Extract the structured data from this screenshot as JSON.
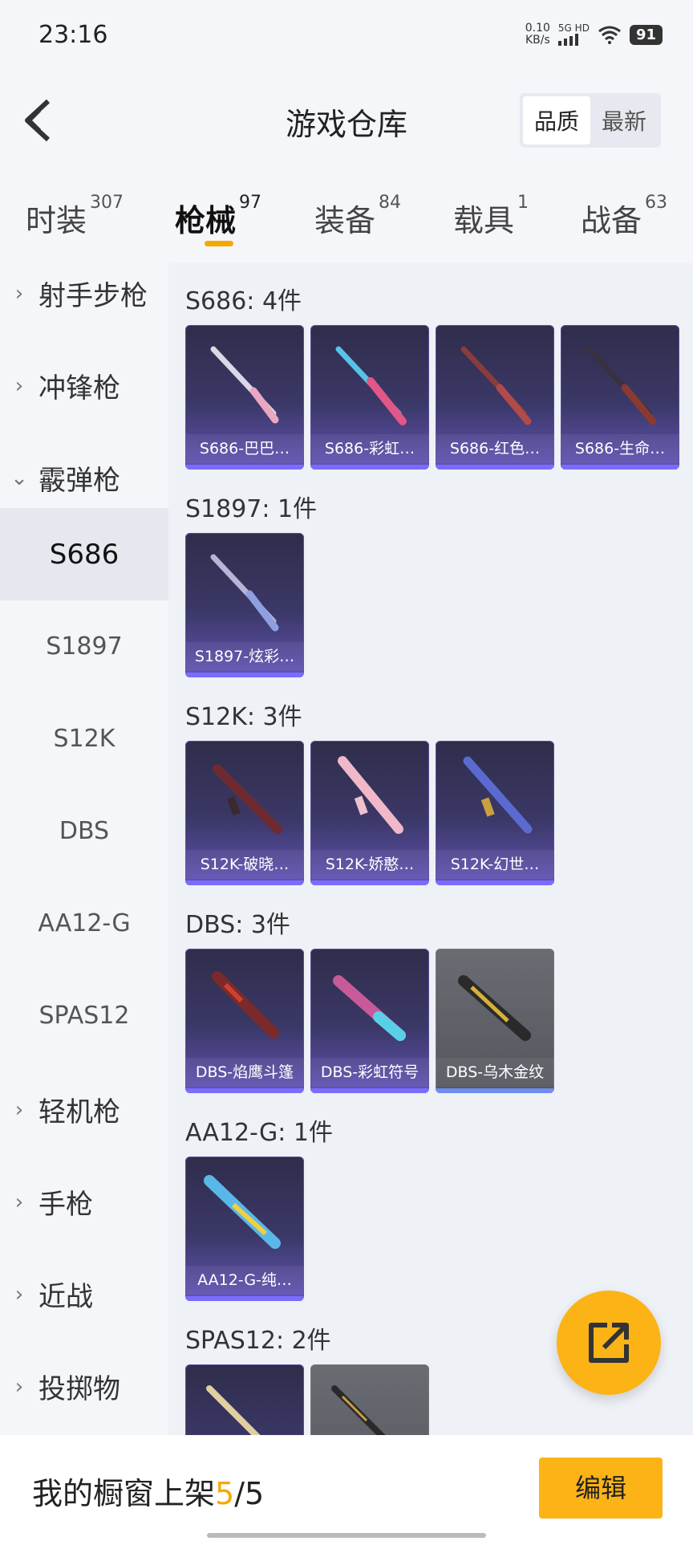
{
  "status": {
    "time": "23:16",
    "net_top": "0.10",
    "net_bottom": "KB/s",
    "signal": "5G HD",
    "battery": "91"
  },
  "header": {
    "title": "游戏仓库",
    "sort": [
      "品质",
      "最新"
    ]
  },
  "tabs": [
    {
      "label": "时装",
      "count": "307"
    },
    {
      "label": "枪械",
      "count": "97"
    },
    {
      "label": "装备",
      "count": "84"
    },
    {
      "label": "载具",
      "count": "1"
    },
    {
      "label": "战备",
      "count": "63"
    }
  ],
  "sidebar": {
    "cats": [
      "射手步枪",
      "冲锋枪",
      "霰弹枪",
      "轻机枪",
      "手枪",
      "近战",
      "投掷物"
    ],
    "subs": [
      "S686",
      "S1897",
      "S12K",
      "DBS",
      "AA12-G",
      "SPAS12"
    ]
  },
  "groups": [
    {
      "title": "S686: 4件",
      "items": [
        "S686-巴巴…",
        "S686-彩虹…",
        "S686-红色…",
        "S686-生命…"
      ]
    },
    {
      "title": "S1897: 1件",
      "items": [
        "S1897-炫彩…"
      ]
    },
    {
      "title": "S12K: 3件",
      "items": [
        "S12K-破晓…",
        "S12K-娇憨…",
        "S12K-幻世…"
      ]
    },
    {
      "title": "DBS: 3件",
      "items": [
        "DBS-焰鹰斗篷",
        "DBS-彩虹符号",
        "DBS-乌木金纹"
      ]
    },
    {
      "title": "AA12-G: 1件",
      "items": [
        "AA12-G-纯…"
      ]
    },
    {
      "title": "SPAS12: 2件",
      "items": [
        "",
        ""
      ]
    }
  ],
  "bottom": {
    "label": "我的橱窗上架",
    "current": "5",
    "total": "/5",
    "edit": "编辑"
  },
  "colors": {
    "accent": "#fbb316",
    "purple_card": "#3b3868",
    "grey_card": "#5d5f66"
  },
  "icons": [
    "back-icon",
    "share-icon",
    "chevron-right-icon",
    "chevron-down-icon",
    "wifi-icon"
  ]
}
